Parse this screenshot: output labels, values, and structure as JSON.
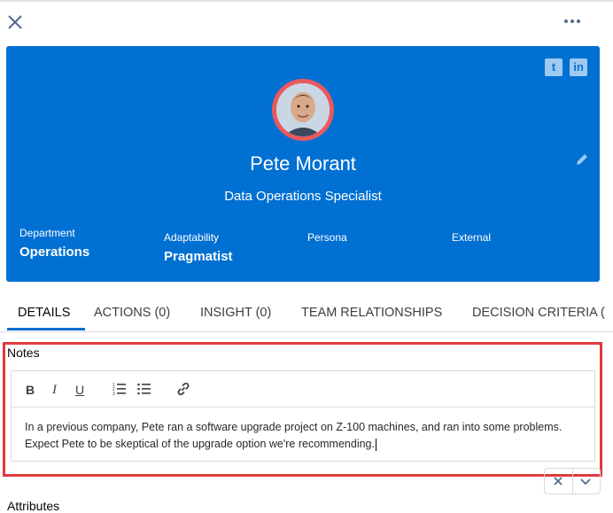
{
  "header": {
    "close_icon": "close-icon",
    "more_icon": "more-horizontal-icon"
  },
  "contact": {
    "name": "Pete Morant",
    "title": "Data Operations Specialist",
    "social": {
      "twitter_letter": "t",
      "linkedin_letter": "in"
    },
    "fields": [
      {
        "label": "Department",
        "value": "Operations"
      },
      {
        "label": "Adaptability",
        "value": "Pragmatist"
      },
      {
        "label": "Persona",
        "value": ""
      },
      {
        "label": "External",
        "value": ""
      }
    ],
    "colors": {
      "card": "#0070d2",
      "avatar_ring": "#e9595e"
    }
  },
  "tabs": [
    {
      "label": "DETAILS",
      "active": true
    },
    {
      "label": "ACTIONS (0)"
    },
    {
      "label": "INSIGHT (0)"
    },
    {
      "label": "TEAM RELATIONSHIPS"
    },
    {
      "label": "DECISION CRITERIA ("
    }
  ],
  "notes": {
    "label": "Notes",
    "toolbar": {
      "bold": "B",
      "italic": "I",
      "underline": "U",
      "numbered_list_icon": "numbered-list-icon",
      "bullet_list_icon": "bullet-list-icon",
      "link_icon": "link-icon"
    },
    "text": "In a previous company, Pete ran a software upgrade project on Z-100 machines, and ran into some problems. Expect Pete to be skeptical of the upgrade option we're recommending."
  },
  "next_section": "Attributes"
}
